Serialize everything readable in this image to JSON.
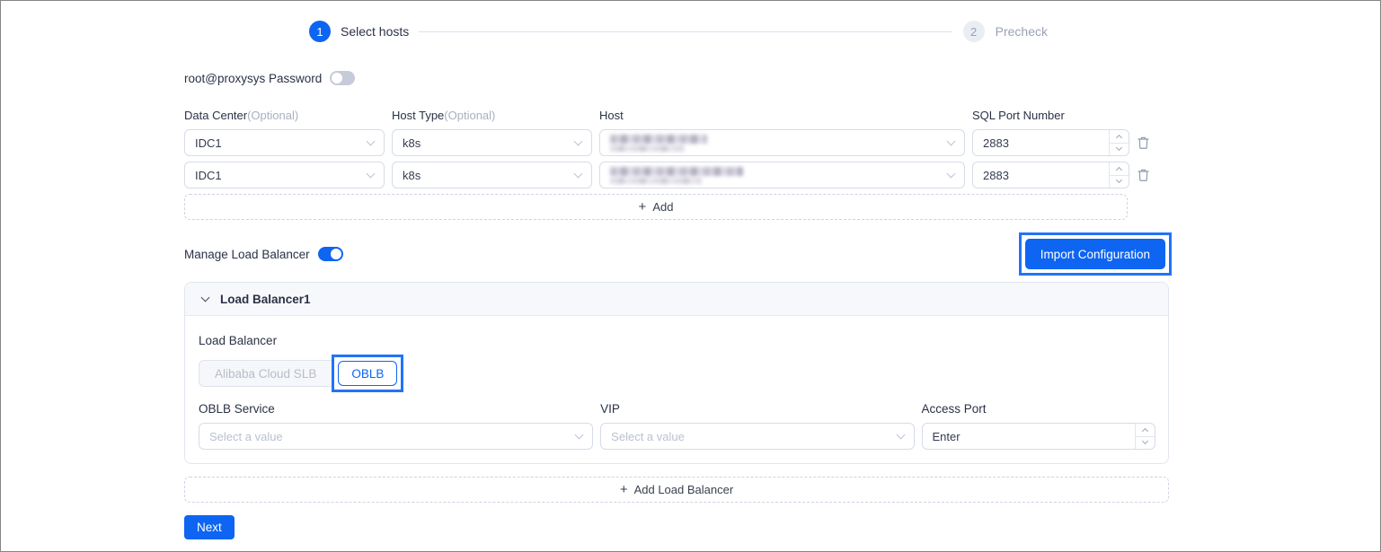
{
  "colors": {
    "primary_blue": "#0d65f2",
    "annotation_blue": "#2273f7",
    "toggle_off_gray": "#c5cbd8",
    "step_inactive_bg": "#e9edf4",
    "dark_text": "#2a3245",
    "muted_text": "#99a2b4",
    "placeholder_text": "#b9c1d0",
    "input_border": "#d6dce8",
    "panel_header_bg": "#f7f8fb"
  },
  "steps": {
    "step1": {
      "number": "1",
      "label": "Select hosts",
      "state": "active"
    },
    "step2": {
      "number": "2",
      "label": "Precheck",
      "state": "inactive"
    }
  },
  "password": {
    "label": "root@proxysys Password",
    "toggle_state": "off"
  },
  "host_form": {
    "headers": {
      "data_center": "Data Center",
      "data_center_optional": "(Optional)",
      "host_type": "Host Type",
      "host_type_optional": "(Optional)",
      "host": "Host",
      "sql_port": "SQL Port Number"
    },
    "rows": [
      {
        "data_center": "IDC1",
        "host_type": "k8s",
        "host_redacted": true,
        "sql_port": "2883"
      },
      {
        "data_center": "IDC1",
        "host_type": "k8s",
        "host_redacted": true,
        "sql_port": "2883"
      }
    ],
    "add_button": "Add"
  },
  "load_balancer": {
    "toggle_label": "Manage Load Balancer",
    "toggle_state": "on",
    "import_button": "Import Configuration",
    "panel": {
      "title": "Load Balancer1",
      "type_label": "Load Balancer",
      "type_option_slb": "Alibaba Cloud SLB",
      "type_option_oblb": "OBLB",
      "selected_type": "OBLB",
      "oblb_service_label": "OBLB Service",
      "oblb_service_placeholder": "Select a value",
      "vip_label": "VIP",
      "vip_placeholder": "Select a value",
      "access_port_label": "Access Port",
      "access_port_placeholder": "Enter"
    },
    "add_button": "Add Load Balancer"
  },
  "next_button": "Next",
  "icons": {
    "plus": "+"
  }
}
